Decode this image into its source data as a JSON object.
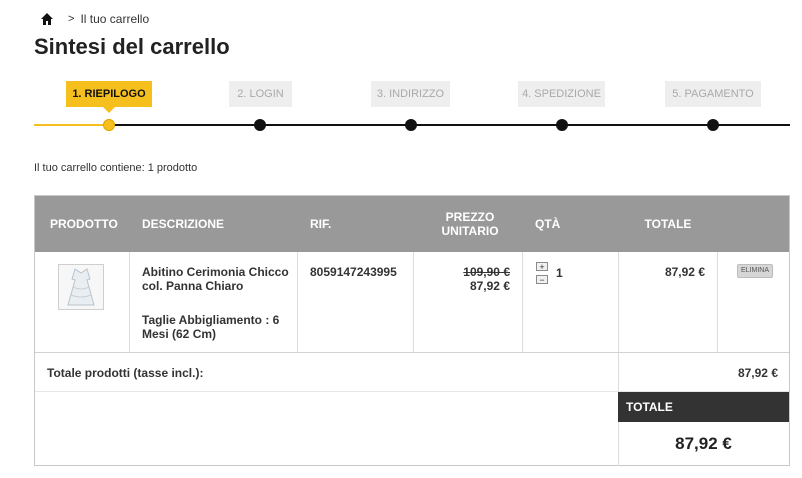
{
  "breadcrumb": {
    "home_icon": "home-icon",
    "separator": ">",
    "current": "Il tuo carrello"
  },
  "page": {
    "title": "Sintesi del carrello"
  },
  "steps": [
    {
      "label": "1. RIEPILOGO",
      "active": true
    },
    {
      "label": "2. LOGIN",
      "active": false
    },
    {
      "label": "3. INDIRIZZO",
      "active": false
    },
    {
      "label": "4. SPEDIZIONE",
      "active": false
    },
    {
      "label": "5. PAGAMENTO",
      "active": false
    }
  ],
  "cart_summary": "Il tuo carrello contiene: 1 prodotto",
  "table": {
    "headers": {
      "product": "PRODOTTO",
      "description": "DESCRIZIONE",
      "ref": "RIF.",
      "unit_price": "PREZZO UNITARIO",
      "qty": "QTÀ",
      "total": "TOTALE"
    },
    "rows": [
      {
        "thumbnail_icon": "dress-thumbnail",
        "name": "Abitino Cerimonia Chicco col. Panna Chiaro",
        "attribute": "Taglie Abbigliamento : 6 Mesi (62 Cm)",
        "ref": "8059147243995",
        "old_price": "109,90 €",
        "price": "87,92 €",
        "qty": "1",
        "qty_plus": "+",
        "qty_minus": "−",
        "total": "87,92 €",
        "delete_label": "ELIMINA"
      }
    ]
  },
  "totals": {
    "products_label": "Totale prodotti (tasse incl.):",
    "products_value": "87,92 €",
    "total_label": "TOTALE",
    "total_value": "87,92 €"
  },
  "colors": {
    "accent": "#f5bf1d",
    "header_bg": "#999999",
    "total_bar": "#333333",
    "inactive_step": "#eeeeee"
  }
}
